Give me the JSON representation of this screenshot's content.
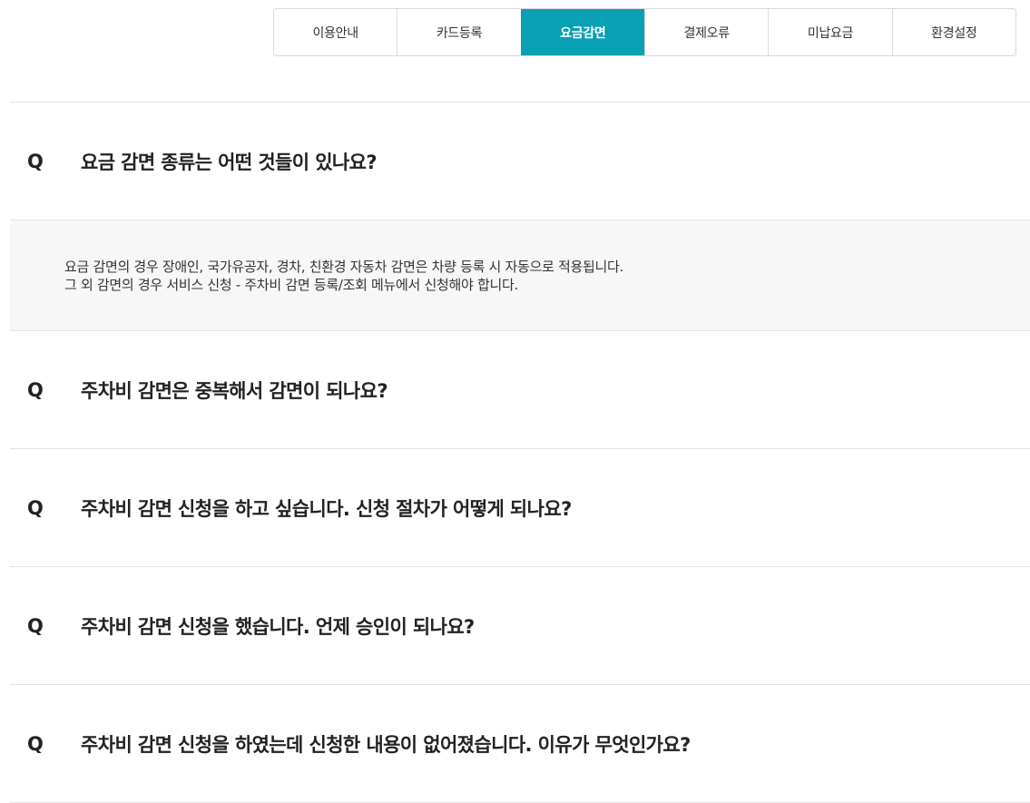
{
  "tabs": [
    {
      "label": "이용안내",
      "active": false
    },
    {
      "label": "카드등록",
      "active": false
    },
    {
      "label": "요금감면",
      "active": true
    },
    {
      "label": "결제오류",
      "active": false
    },
    {
      "label": "미납요금",
      "active": false
    },
    {
      "label": "환경설정",
      "active": false
    }
  ],
  "colors": {
    "accent": "#0aa0b4",
    "answer_bg": "#f7f7f7",
    "divider": "#e2e2e2"
  },
  "faq": {
    "q_mark": "Q",
    "items": [
      {
        "question": "요금 감면 종류는 어떤 것들이 있나요?",
        "expanded": true,
        "answer": [
          "요금 감면의 경우 장애인, 국가유공자, 경차, 친환경 자동차 감면은 차량 등록 시 자동으로 적용됩니다.",
          "그 외 감면의 경우 서비스 신청 - 주차비 감면 등록/조회 메뉴에서 신청해야 합니다."
        ]
      },
      {
        "question": "주차비 감면은 중복해서 감면이 되나요?",
        "expanded": false
      },
      {
        "question": "주차비 감면 신청을 하고 싶습니다. 신청 절차가 어떻게 되나요?",
        "expanded": false
      },
      {
        "question": "주차비 감면 신청을 했습니다. 언제 승인이 되나요?",
        "expanded": false
      },
      {
        "question": "주차비 감면 신청을 하였는데 신청한 내용이 없어졌습니다. 이유가 무엇인가요?",
        "expanded": false
      }
    ]
  }
}
